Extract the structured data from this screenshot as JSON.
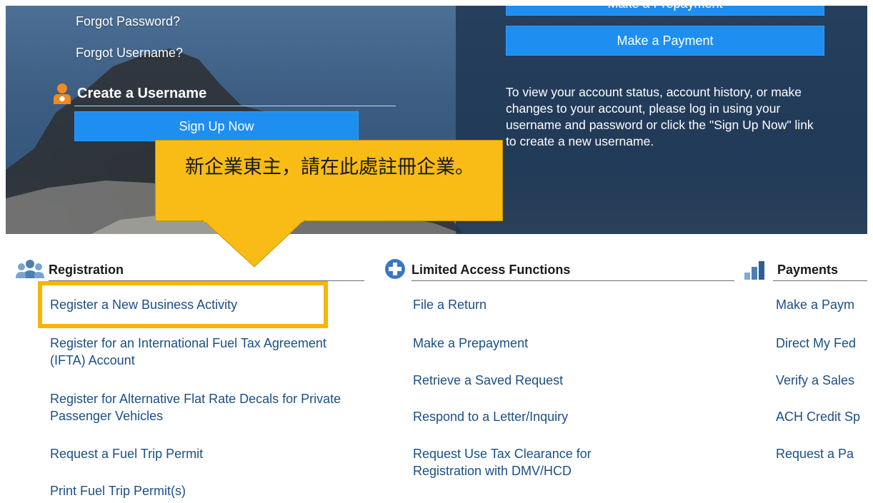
{
  "login": {
    "forgot_password": "Forgot Password?",
    "forgot_username": "Forgot Username?",
    "create_username_title": "Create a Username",
    "sign_up_label": "Sign Up Now"
  },
  "account": {
    "prepayment_label": "Make a Prepayment",
    "payment_label": "Make a Payment",
    "info_text": "To view your account status, account history, or make changes to your account, please log in using your username and password or click the \"Sign Up Now\" link to create a new username."
  },
  "callout": {
    "text": "新企業東主，請在此處註冊企業。",
    "color": "#f9bc17"
  },
  "registration": {
    "title": "Registration",
    "icon": "group-icon",
    "links": [
      "Register a New Business Activity",
      "Register for an International Fuel Tax Agreement (IFTA) Account",
      "Register for Alternative Flat Rate Decals for Private Passenger Vehicles",
      "Request a Fuel Trip Permit",
      "Print Fuel Trip Permit(s)"
    ]
  },
  "limited": {
    "title": "Limited Access Functions",
    "icon": "plus-circle-icon",
    "links": [
      "File a Return",
      "Make a Prepayment",
      "Retrieve a Saved Request",
      "Respond to a Letter/Inquiry",
      "Request Use Tax Clearance for Registration with DMV/HCD"
    ]
  },
  "payments": {
    "title": "Payments",
    "icon": "bar-chart-icon",
    "links": [
      "Make a Paym",
      "Direct My Fed",
      "Verify a Sales",
      "ACH Credit Sp",
      "Request a Pa"
    ]
  },
  "colors": {
    "button_blue": "#1f8ef1",
    "link_blue": "#1a4f86",
    "highlight": "#f7b500"
  }
}
